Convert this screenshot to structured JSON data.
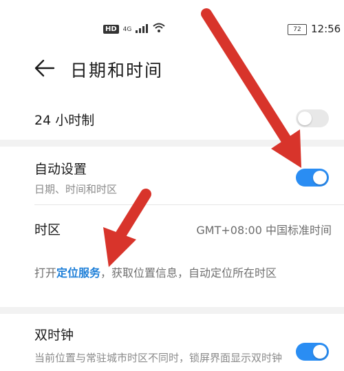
{
  "status_bar": {
    "hd": "HD",
    "network": "4G",
    "battery": "72",
    "time": "12:56"
  },
  "header": {
    "title": "日期和时间"
  },
  "rows": {
    "hour24": {
      "label": "24 小时制",
      "on": false
    },
    "auto_set": {
      "label": "自动设置",
      "sub": "日期、时间和时区",
      "on": true
    },
    "timezone": {
      "label": "时区",
      "value": "GMT+08:00 中国标准时间"
    },
    "hint": {
      "prefix": "打开",
      "link": "定位服务",
      "suffix": "，获取位置信息，自动定位所在时区"
    },
    "dual_clock": {
      "label": "双时钟",
      "sub": "当前位置与常驻城市时区不同时，锁屏界面显示双时钟",
      "on": true
    }
  },
  "colors": {
    "accent": "#2a8df3",
    "annotation_arrow": "#d8342b"
  }
}
